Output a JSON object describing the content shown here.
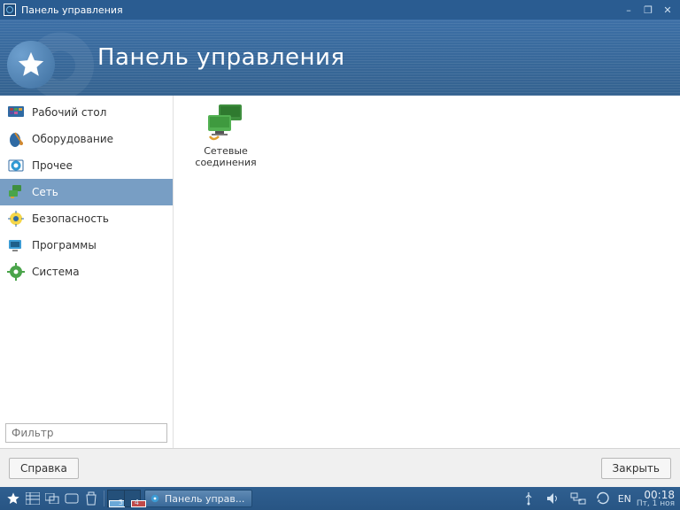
{
  "window": {
    "title": "Панель управления"
  },
  "banner": {
    "title": "Панель управления"
  },
  "sidebar": {
    "categories": [
      {
        "id": "desktop",
        "label": "Рабочий стол"
      },
      {
        "id": "hardware",
        "label": "Оборудование"
      },
      {
        "id": "other",
        "label": "Прочее"
      },
      {
        "id": "network",
        "label": "Сеть"
      },
      {
        "id": "security",
        "label": "Безопасность"
      },
      {
        "id": "programs",
        "label": "Программы"
      },
      {
        "id": "system",
        "label": "Система"
      }
    ],
    "selected": "network",
    "filter_placeholder": "Фильтр"
  },
  "main": {
    "items": [
      {
        "id": "net-connections",
        "label_line1": "Сетевые",
        "label_line2": "соединения"
      }
    ]
  },
  "buttons": {
    "help": "Справка",
    "close": "Закрыть"
  },
  "taskbar": {
    "active_task": "Панель управ...",
    "lang": "EN",
    "time": "00:18",
    "date": "Пт, 1 ноя",
    "ws_labels": [
      "3",
      "4"
    ]
  }
}
